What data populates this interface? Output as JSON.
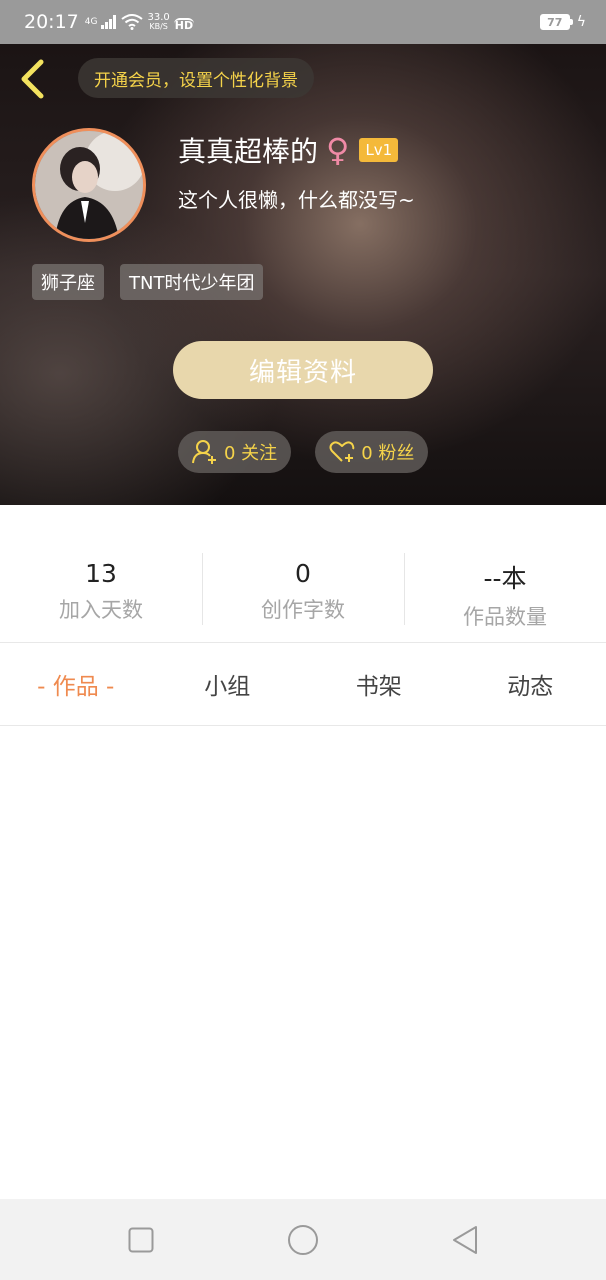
{
  "status_bar": {
    "time": "20:17",
    "network_type": "4G",
    "speed_value": "33.0",
    "speed_unit": "KB/S",
    "hd": "HD",
    "battery": "77"
  },
  "header": {
    "vip_prompt": "开通会员，设置个性化背景",
    "username": "真真超棒的",
    "gender_symbol": "♀",
    "level": "Lv1",
    "bio": "这个人很懒，什么都没写~",
    "tags": [
      "狮子座",
      "TNT时代少年团"
    ],
    "edit_button": "编辑资料",
    "following": "0 关注",
    "followers": "0 粉丝"
  },
  "stats": [
    {
      "value": "13",
      "label": "加入天数"
    },
    {
      "value": "0",
      "label": "创作字数"
    },
    {
      "value": "--本",
      "label": "作品数量"
    }
  ],
  "tabs": [
    "- 作品 -",
    "小组",
    "书架",
    "动态"
  ],
  "colors": {
    "accent": "#ef8a4f",
    "vip_text": "#f5d34a",
    "edit_button_bg": "#e8d7ac",
    "level_badge": "#f4b93a",
    "avatar_border": "#ef8f5b"
  }
}
